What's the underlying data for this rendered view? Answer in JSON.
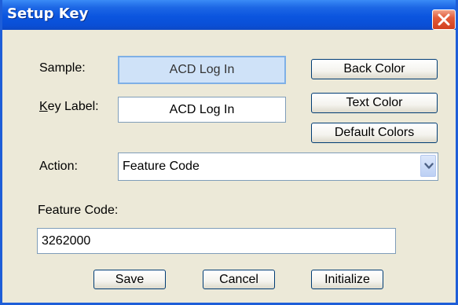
{
  "window": {
    "title": "Setup Key"
  },
  "icons": {
    "close": "close-icon",
    "dropdown": "chevron-down-icon"
  },
  "colors": {
    "titlebar": "#0a52dc",
    "dialog_bg": "#ece9d8",
    "sample_bg": "#cfe2f8",
    "close_btn": "#e35b3a"
  },
  "form": {
    "sample_label": "Sample:",
    "sample_text": "ACD Log In",
    "key_label_prefix": "K",
    "key_label_rest": "ey Label:",
    "key_label_value": "ACD Log In",
    "action_label": "Action:",
    "action_value": "Feature Code",
    "feature_code_label": "Feature Code:",
    "feature_code_value": "3262000"
  },
  "buttons": {
    "back_color": "Back Color",
    "text_color": "Text Color",
    "default_colors": "Default Colors",
    "save": "Save",
    "cancel": "Cancel",
    "initialize": "Initialize"
  }
}
